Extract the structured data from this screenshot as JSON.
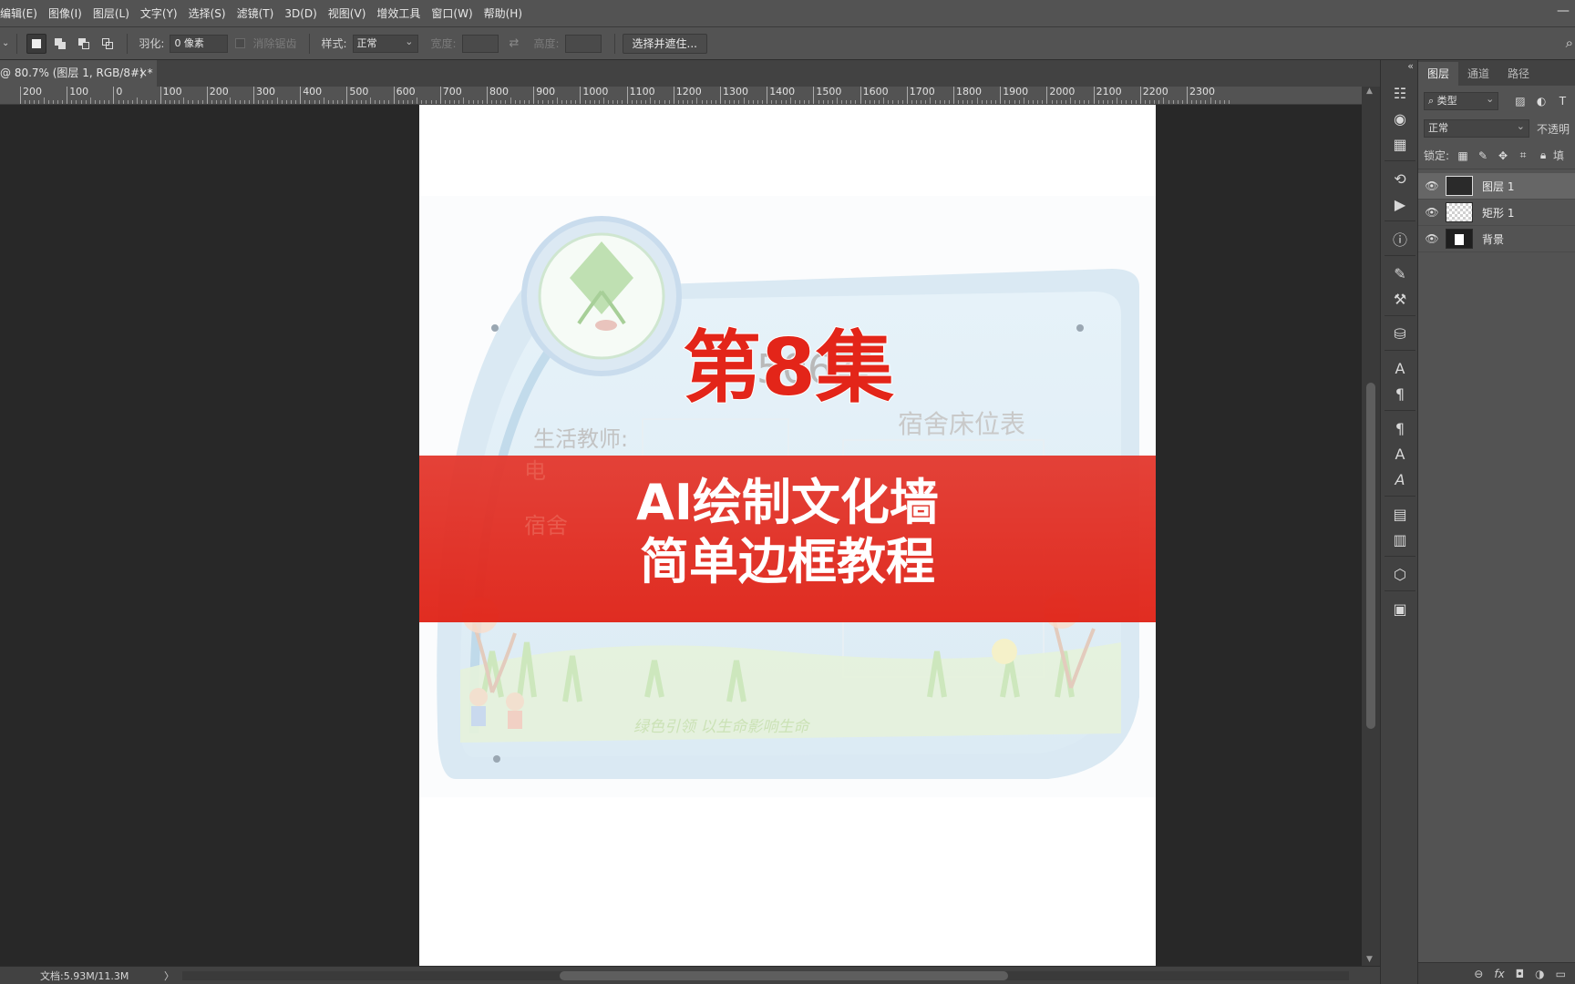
{
  "menu": [
    "编辑(E)",
    "图像(I)",
    "图层(L)",
    "文字(Y)",
    "选择(S)",
    "滤镜(T)",
    "3D(D)",
    "视图(V)",
    "增效工具",
    "窗口(W)",
    "帮助(H)"
  ],
  "window_control": "—",
  "options": {
    "feather_label": "羽化:",
    "feather_value": "0 像素",
    "antialias_label": "消除锯齿",
    "style_label": "样式:",
    "style_value": "正常",
    "width_label": "宽度:",
    "height_label": "高度:",
    "select_mask_button": "选择并遮住..."
  },
  "document_tab": {
    "title": "@ 80.7% (图层 1, RGB/8#) *",
    "close": "×"
  },
  "ruler_labels": [
    "200",
    "100",
    "0",
    "100",
    "200",
    "300",
    "400",
    "500",
    "600",
    "700",
    "800",
    "900",
    "1000",
    "1100",
    "1200",
    "1300",
    "1400",
    "1500",
    "1600",
    "1700",
    "1800",
    "1900",
    "2000",
    "2100",
    "2200",
    "2300"
  ],
  "artwork": {
    "board_title": "506室",
    "board_subtitle": "宿舍床位表",
    "teacher_label": "生活教师:",
    "phone_label": "电",
    "dorm_label": "宿舍",
    "slogan": "绿色引领  以生命影响生命",
    "episode": "第8集",
    "banner_line1": "AI绘制文化墙",
    "banner_line2": "简单边框教程"
  },
  "status": {
    "doc_size": "文档:5.93M/11.3M",
    "arrow": "〉"
  },
  "layers_panel": {
    "tabs": [
      "图层",
      "通道",
      "路径"
    ],
    "filter_label": "类型",
    "blend_mode": "正常",
    "opacity_label": "不透明",
    "lock_label": "锁定:",
    "fill_label": "填",
    "layers": [
      {
        "name": "图层 1",
        "selected": true
      },
      {
        "name": "矩形 1",
        "selected": false
      },
      {
        "name": "背景",
        "selected": false
      }
    ],
    "footer_icons": [
      "link-icon",
      "fx-icon",
      "mask-icon",
      "adjustment-icon",
      "folder-icon"
    ],
    "footer_fx": "fx"
  }
}
